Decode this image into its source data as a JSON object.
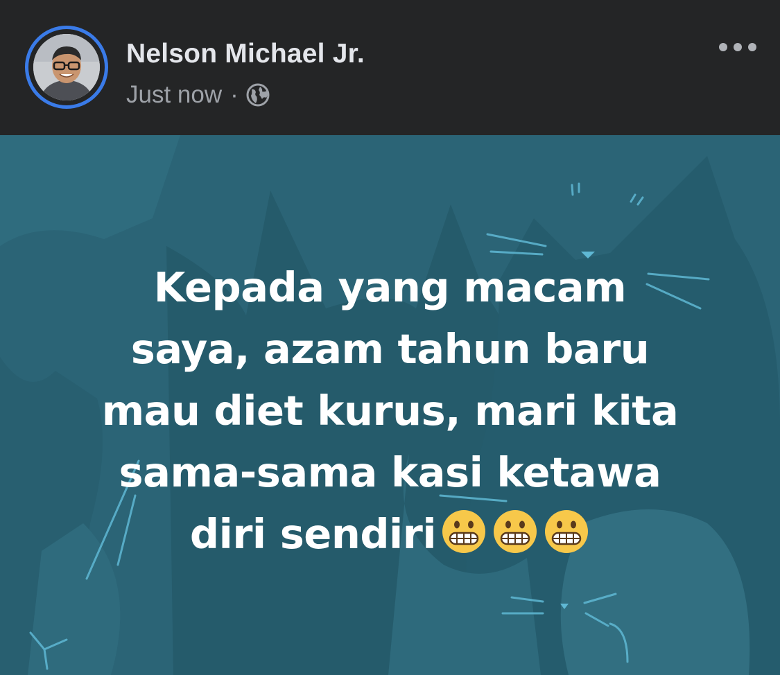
{
  "author": {
    "name": "Nelson Michael Jr.",
    "timestamp": "Just now",
    "separator": "·",
    "audience_icon": "globe-icon"
  },
  "actions": {
    "more_icon": "more-options-icon"
  },
  "post": {
    "lines": [
      "Kepada yang macam",
      "saya, azam tahun baru",
      "mau diet kurus, mari kita",
      "sama-sama kasi ketawa",
      "diri sendiri"
    ],
    "emoji": [
      "grimacing-face-emoji",
      "grimacing-face-emoji",
      "grimacing-face-emoji"
    ],
    "background": "teal cats pattern"
  },
  "colors": {
    "header_bg": "#242526",
    "ring": "#3a7be8",
    "name": "#e4e6eb",
    "meta": "#9ea2a8",
    "post_bg": "#2b6476",
    "post_text": "#ffffff"
  }
}
